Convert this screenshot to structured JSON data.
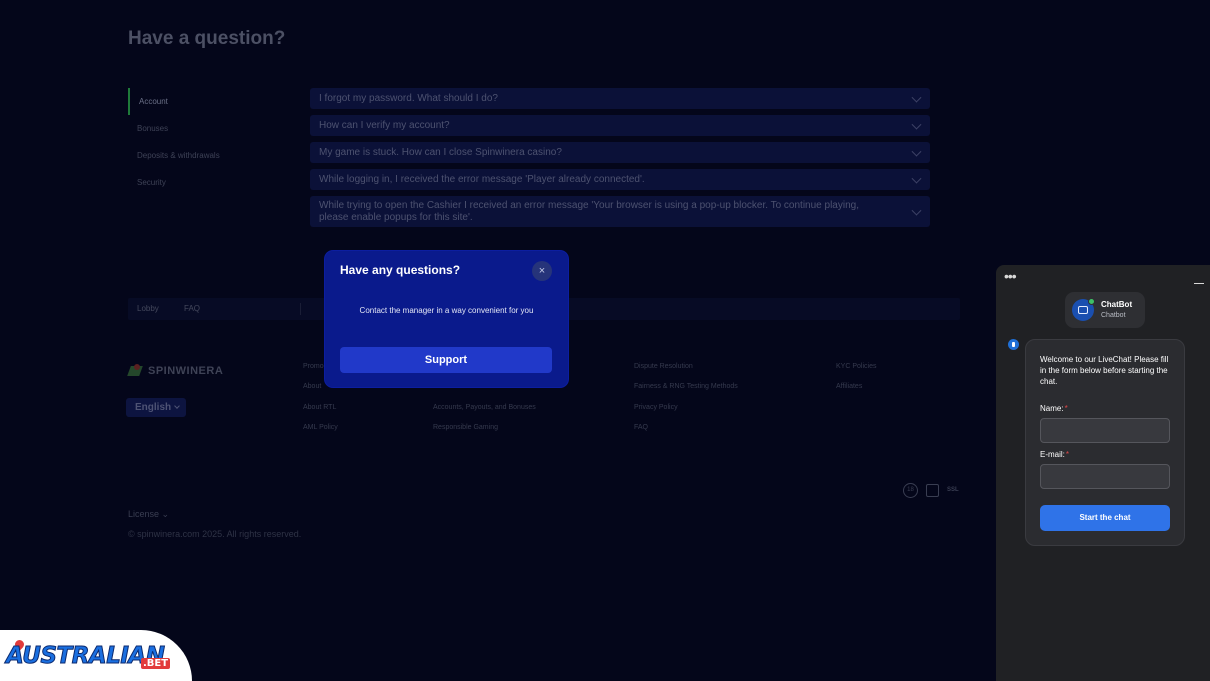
{
  "page": {
    "title": "Have a question?",
    "faq_categories": [
      "Account",
      "Bonuses",
      "Deposits & withdrawals",
      "Security"
    ],
    "faq_questions": [
      "I forgot my password. What should I do?",
      "How can I verify my account?",
      "My game is stuck. How can I close Spinwinera casino?",
      "While logging in, I received the error message 'Player already connected'.",
      "While trying to open the Cashier I received an error message 'Your browser is using a pop-up blocker. To continue playing, please enable popups for this site'."
    ],
    "nav": {
      "lobby": "Lobby",
      "faq": "FAQ"
    },
    "logo_text": "SPINWINERA",
    "language": "English",
    "footer_links": {
      "c1": [
        "Promo",
        "About",
        "About RTL",
        "AML Policy"
      ],
      "c2": [
        "Accounts, Payouts, and Bonuses",
        "Responsible Gaming"
      ],
      "c3": [
        "Dispute Resolution",
        "Fairness & RNG Testing Methods",
        "Privacy Policy",
        "FAQ"
      ],
      "c4": [
        "KYC Policies",
        "Affiliates"
      ]
    },
    "badges": {
      "age": "18",
      "ssl": "SSL"
    },
    "license": "License",
    "copyright": "© spinwinera.com 2025. All rights reserved."
  },
  "modal": {
    "title": "Have any questions?",
    "close_icon": "×",
    "text": "Contact the manager in a way convenient for you",
    "button": "Support",
    "bg_color": "#0a1a8c"
  },
  "chat": {
    "menu_icon": "•••",
    "bot_name": "ChatBot",
    "bot_sub": "Chatbot",
    "welcome": "Welcome to our LiveChat! Please fill in the form below before starting the chat.",
    "name_label": "Name:",
    "email_label": "E-mail:",
    "required_mark": "*",
    "start_button": "Start the chat",
    "accent": "#2f73e8"
  },
  "watermark": {
    "text": "AUSTRALIAN",
    "suffix": ".BET"
  }
}
